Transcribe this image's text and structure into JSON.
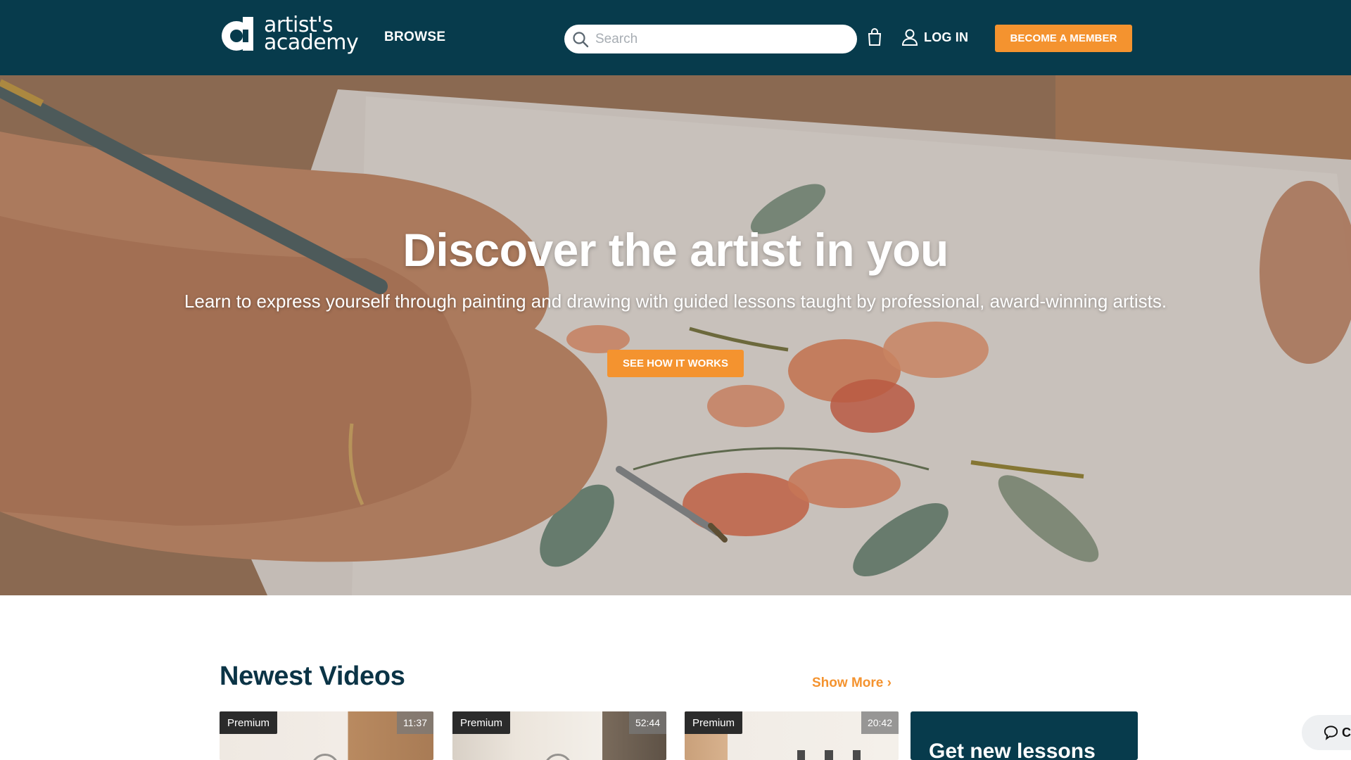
{
  "header": {
    "logo": {
      "line1": "artist's",
      "line2": "academy"
    },
    "browse_label": "BROWSE",
    "search": {
      "placeholder": "Search",
      "value": ""
    },
    "cart_icon": "shopping-bag-icon",
    "login_label": "LOG IN",
    "member_button": "BECOME A MEMBER"
  },
  "hero": {
    "title": "Discover the artist in you",
    "subtitle": "Learn to express yourself through painting and drawing with guided lessons taught by professional, award-winning artists.",
    "cta": "SEE HOW IT WORKS"
  },
  "newest": {
    "title": "Newest Videos",
    "show_more": "Show More ›",
    "videos": [
      {
        "badge": "Premium",
        "duration": "11:37"
      },
      {
        "badge": "Premium",
        "duration": "52:44"
      },
      {
        "badge": "Premium",
        "duration": "20:42"
      }
    ],
    "promo_title": "Get new lessons"
  },
  "chat": {
    "label": "C"
  },
  "colors": {
    "nav_bg": "#073b4c",
    "accent": "#f4932f",
    "heading": "#0b3446"
  }
}
